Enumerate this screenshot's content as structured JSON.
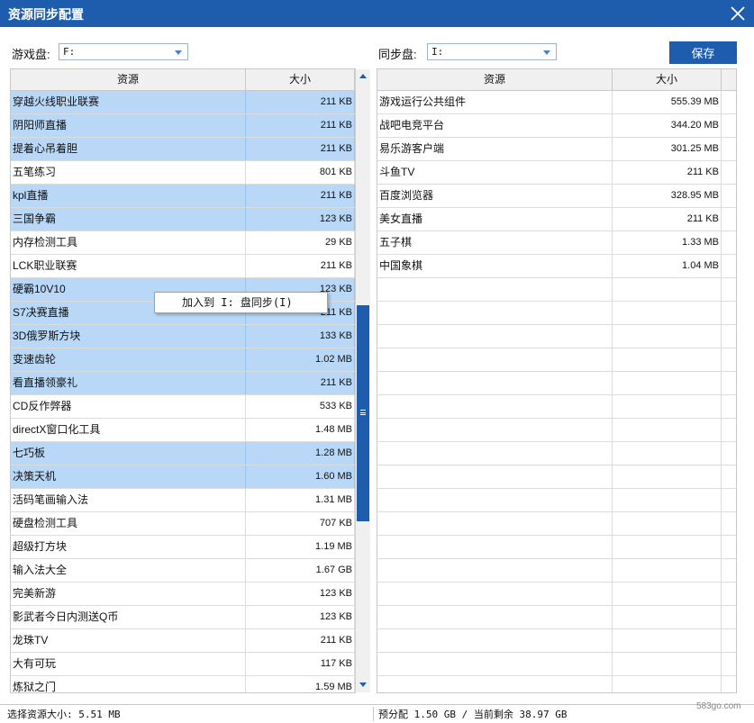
{
  "window": {
    "title": "资源同步配置"
  },
  "toolbar": {
    "game_drive_label": "游戏盘:",
    "game_drive_value": "F:",
    "sync_drive_label": "同步盘:",
    "sync_drive_value": "I:",
    "save_label": "保存"
  },
  "left_table": {
    "columns": [
      "资源",
      "大小"
    ],
    "rows": [
      {
        "name": "穿越火线职业联赛",
        "size": "211 KB",
        "selected": true
      },
      {
        "name": "阴阳师直播",
        "size": "211 KB",
        "selected": true
      },
      {
        "name": "提着心吊着胆",
        "size": "211 KB",
        "selected": true
      },
      {
        "name": "五笔练习",
        "size": "801 KB",
        "selected": false
      },
      {
        "name": "kpl直播",
        "size": "211 KB",
        "selected": true
      },
      {
        "name": "三国争霸",
        "size": "123 KB",
        "selected": true
      },
      {
        "name": "内存检测工具",
        "size": "29 KB",
        "selected": false
      },
      {
        "name": "LCK职业联赛",
        "size": "211 KB",
        "selected": false
      },
      {
        "name": "硬霸10V10",
        "size": "123 KB",
        "selected": true
      },
      {
        "name": "S7决赛直播",
        "size": "211 KB",
        "selected": true
      },
      {
        "name": "3D俄罗斯方块",
        "size": "133 KB",
        "selected": true
      },
      {
        "name": "变速齿轮",
        "size": "1.02 MB",
        "selected": true
      },
      {
        "name": "看直播领豪礼",
        "size": "211 KB",
        "selected": true
      },
      {
        "name": "CD反作弊器",
        "size": "533 KB",
        "selected": false
      },
      {
        "name": "directX窗口化工具",
        "size": "1.48 MB",
        "selected": false
      },
      {
        "name": "七巧板",
        "size": "1.28 MB",
        "selected": true
      },
      {
        "name": "决策天机",
        "size": "1.60 MB",
        "selected": true
      },
      {
        "name": "活码笔画输入法",
        "size": "1.31 MB",
        "selected": false
      },
      {
        "name": "硬盘检测工具",
        "size": "707 KB",
        "selected": false
      },
      {
        "name": "超级打方块",
        "size": "1.19 MB",
        "selected": false
      },
      {
        "name": "输入法大全",
        "size": "1.67 GB",
        "selected": false
      },
      {
        "name": "完美新游",
        "size": "123 KB",
        "selected": false
      },
      {
        "name": "影武者今日内测送Q币",
        "size": "123 KB",
        "selected": false
      },
      {
        "name": "龙珠TV",
        "size": "211 KB",
        "selected": false
      },
      {
        "name": "大有可玩",
        "size": "117 KB",
        "selected": false
      },
      {
        "name": "炼狱之门",
        "size": "1.59 MB",
        "selected": false
      }
    ]
  },
  "right_table": {
    "columns": [
      "资源",
      "大小"
    ],
    "rows": [
      {
        "name": "游戏运行公共组件",
        "size": "555.39 MB"
      },
      {
        "name": "战吧电竞平台",
        "size": "344.20 MB"
      },
      {
        "name": "易乐游客户端",
        "size": "301.25 MB"
      },
      {
        "name": "斗鱼TV",
        "size": "211 KB"
      },
      {
        "name": "百度浏览器",
        "size": "328.95 MB"
      },
      {
        "name": "美女直播",
        "size": "211 KB"
      },
      {
        "name": "五子棋",
        "size": "1.33 MB"
      },
      {
        "name": "中国象棋",
        "size": "1.04 MB"
      }
    ],
    "empty_rows": 18
  },
  "context_menu": {
    "item_label": "加入到 I: 盘同步(I)"
  },
  "status": {
    "selected_size": "选择资源大小: 5.51 MB",
    "allocation": "预分配 1.50 GB / 当前剩余 38.97 GB"
  },
  "watermark": "583go.com",
  "colors": {
    "titlebar": "#1e5dae",
    "selection": "#b9d8f7",
    "accent": "#1e5dae"
  }
}
